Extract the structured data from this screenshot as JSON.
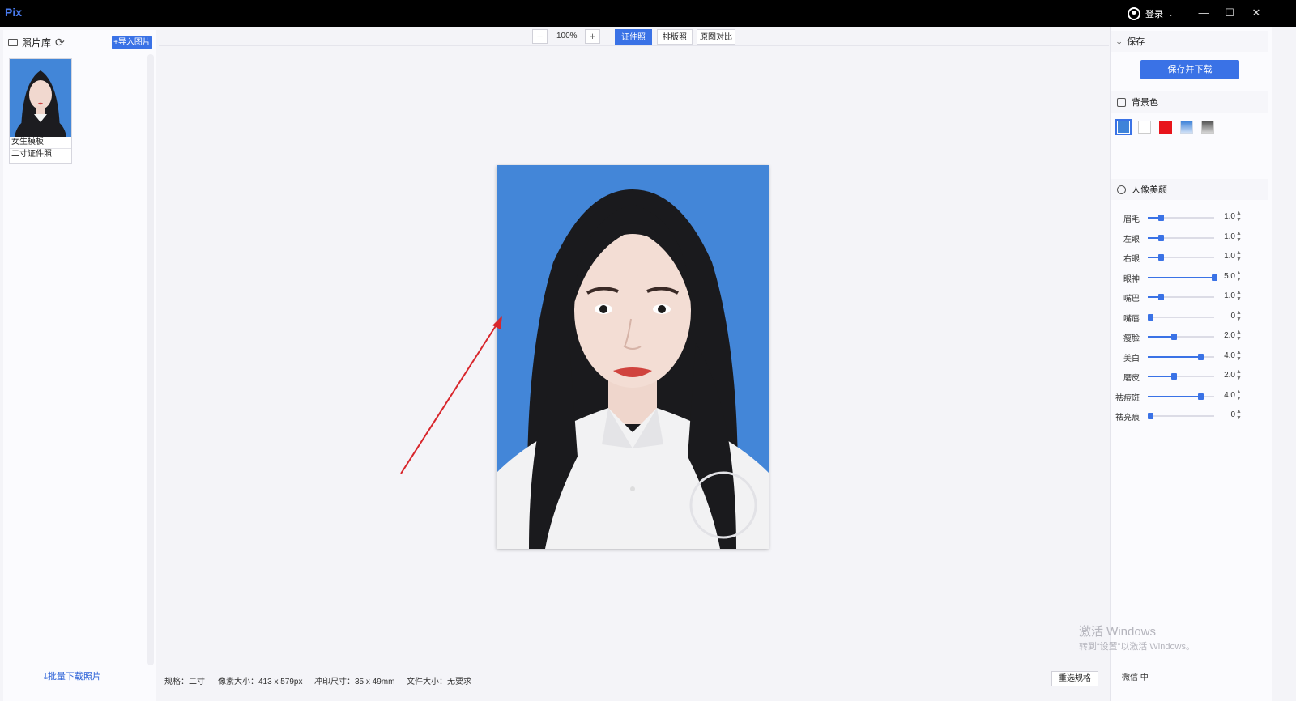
{
  "app": {
    "name": "Pix",
    "login_label": "登录",
    "controls": {
      "minimize": "—",
      "maximize": "☐",
      "close": "✕"
    }
  },
  "sidebar": {
    "title": "照片库",
    "import_label": "+导入图片",
    "items": [
      {
        "name": "女生模板",
        "spec": "二寸证件照"
      }
    ],
    "batch_download_label": "⤓批量下载照片"
  },
  "toolbar": {
    "zoom_minus": "−",
    "zoom_value": "100%",
    "zoom_plus": "+",
    "tabs": [
      {
        "label": "证件照",
        "active": true
      },
      {
        "label": "排版照",
        "active": false
      },
      {
        "label": "原图对比",
        "active": false
      }
    ]
  },
  "status": {
    "spec": "规格：二寸",
    "pixel_size": "像素大小：413 x 579px",
    "print_size": "冲印尺寸：35 x 49mm",
    "file_size": "文件大小：无要求",
    "reselect_label": "重选规格"
  },
  "right_panel": {
    "save": {
      "title": "保存",
      "button_label": "保存并下载"
    },
    "background": {
      "title": "背景色",
      "swatches": [
        {
          "color": "#3f83d9",
          "selected": true
        },
        {
          "color": "#ffffff",
          "selected": false
        },
        {
          "color": "#e8141b",
          "selected": false
        },
        {
          "color": "#6ea6e8",
          "selected": false
        },
        {
          "color": "#8a8a8a",
          "selected": false
        }
      ]
    },
    "beauty": {
      "title": "人像美颜",
      "sliders": [
        {
          "label": "眉毛",
          "value": "1.0",
          "fraction": 0.2
        },
        {
          "label": "左眼",
          "value": "1.0",
          "fraction": 0.2
        },
        {
          "label": "右眼",
          "value": "1.0",
          "fraction": 0.2
        },
        {
          "label": "眼神",
          "value": "5.0",
          "fraction": 1.0
        },
        {
          "label": "嘴巴",
          "value": "1.0",
          "fraction": 0.2
        },
        {
          "label": "嘴唇",
          "value": "0",
          "fraction": 0.0
        },
        {
          "label": "瘦脸",
          "value": "2.0",
          "fraction": 0.4
        },
        {
          "label": "美白",
          "value": "4.0",
          "fraction": 0.8
        },
        {
          "label": "磨皮",
          "value": "2.0",
          "fraction": 0.4
        },
        {
          "label": "祛痘斑",
          "value": "4.0",
          "fraction": 0.8
        },
        {
          "label": "祛亮痕",
          "value": "0",
          "fraction": 0.0
        }
      ]
    }
  },
  "os_overlay": {
    "activate_line1": "激活 Windows",
    "activate_line2": "转到“设置”以激活 Windows。",
    "ime_text": "微信 中"
  },
  "colors": {
    "accent": "#3a72e6",
    "photo_background": "#4386d8",
    "arrow": "#d8262c"
  }
}
